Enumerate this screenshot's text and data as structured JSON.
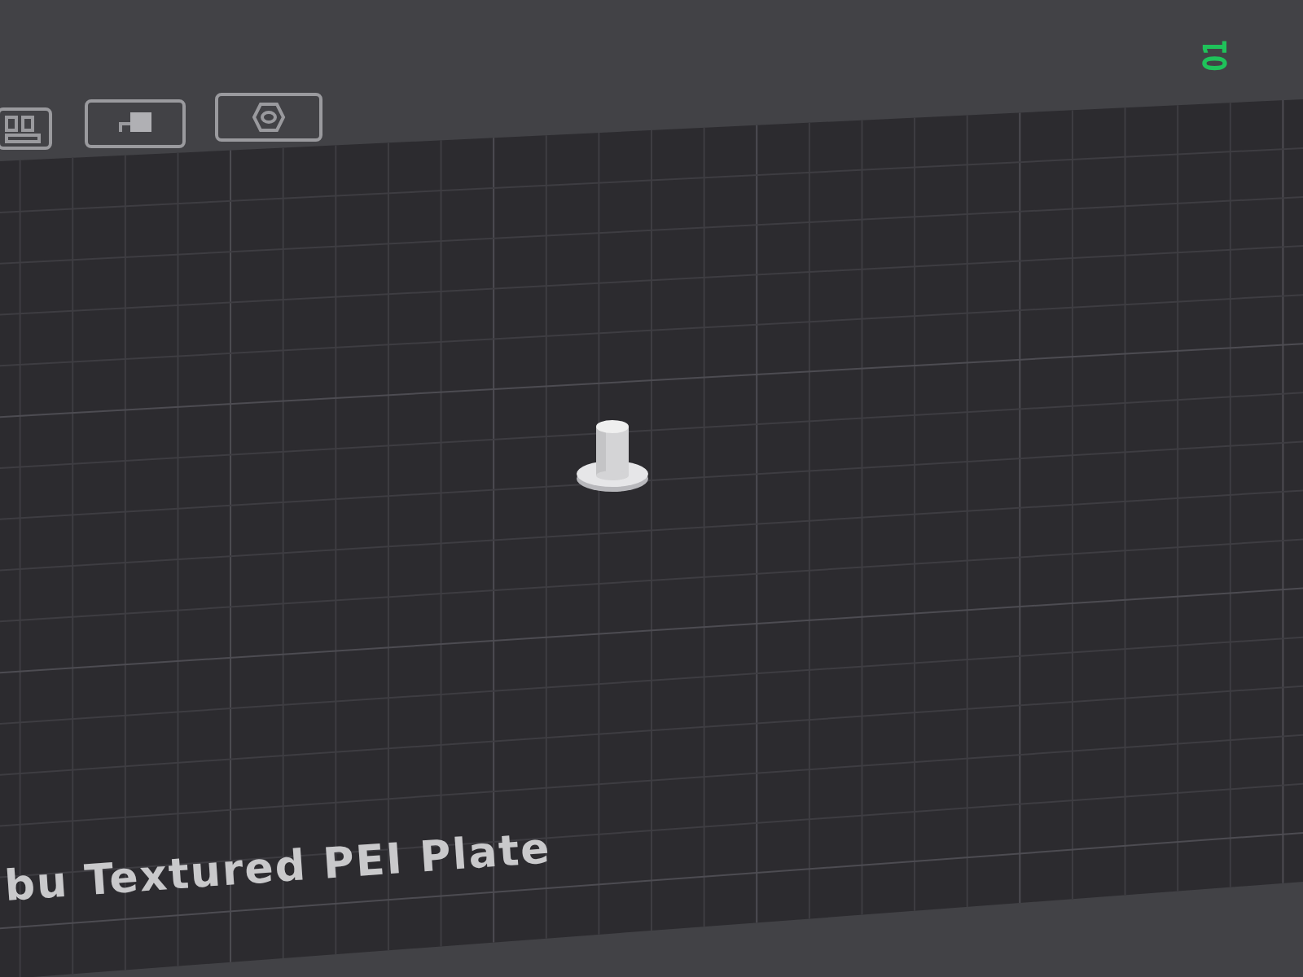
{
  "viewport": {
    "plate_number": "01",
    "bed_label": "bu Textured PEI Plate"
  }
}
